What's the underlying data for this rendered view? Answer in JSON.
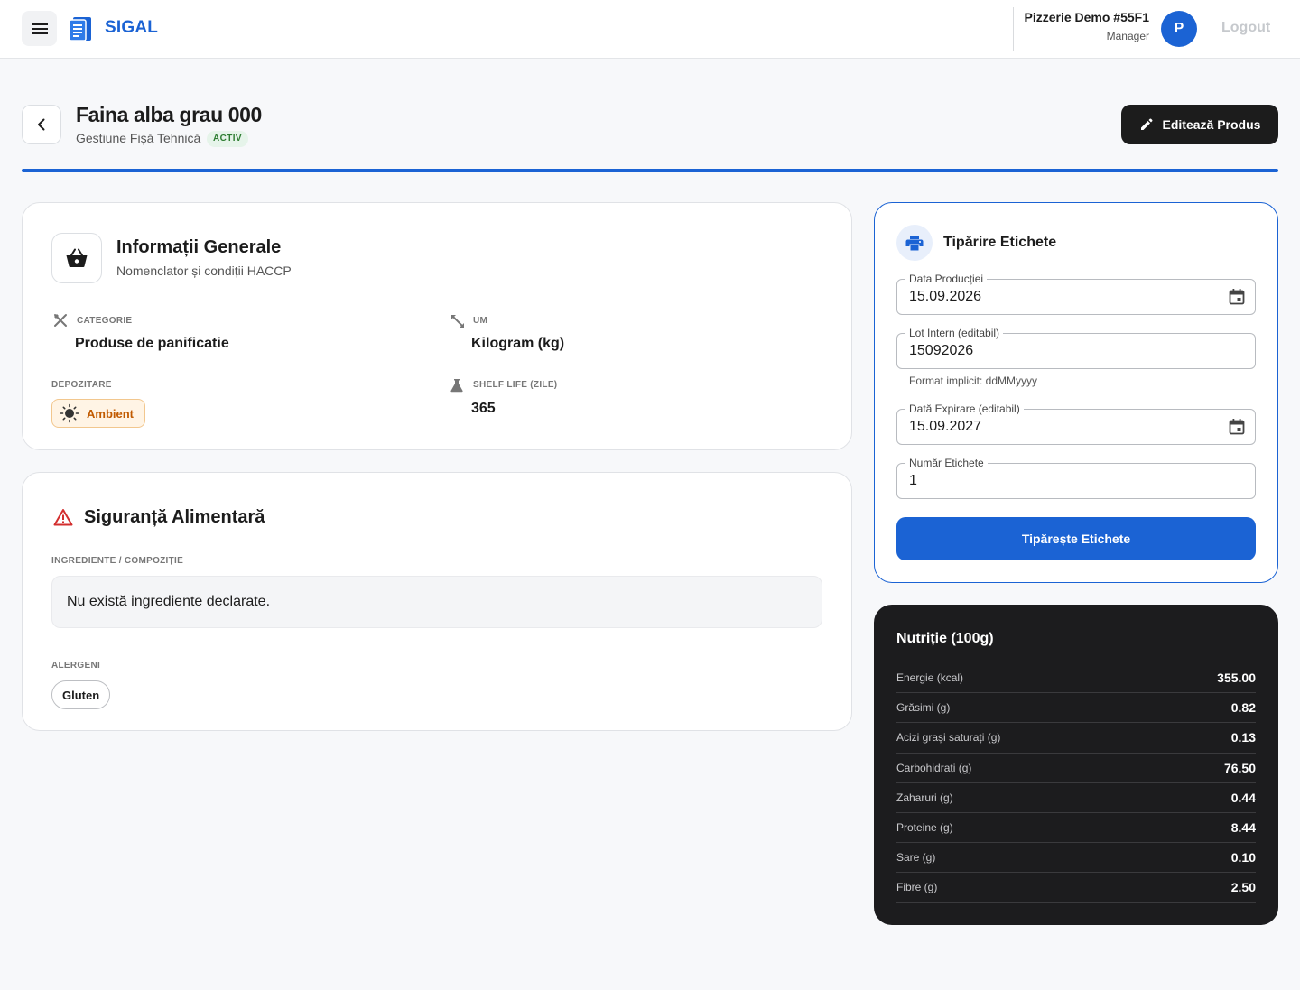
{
  "app": {
    "brand": "SIGAL"
  },
  "user": {
    "name": "Pizzerie Demo #55F1",
    "role": "Manager",
    "avatar_initial": "P",
    "logout_label": "Logout"
  },
  "page": {
    "title": "Faina alba grau 000",
    "subtitle": "Gestiune Fișă Tehnică",
    "status": "ACTIV",
    "edit_label": "Editează Produs"
  },
  "general": {
    "title": "Informații Generale",
    "subtitle": "Nomenclator și condiții HACCP",
    "category_label": "CATEGORIE",
    "category_value": "Produse de panificatie",
    "um_label": "UM",
    "um_value": "Kilogram (kg)",
    "storage_label": "DEPOZITARE",
    "storage_value": "Ambient",
    "shelf_label": "SHELF LIFE (ZILE)",
    "shelf_value": "365"
  },
  "safety": {
    "title": "Siguranță Alimentară",
    "ingredients_label": "INGREDIENTE / COMPOZIȚIE",
    "ingredients_value": "Nu există ingrediente declarate.",
    "allergens_label": "ALERGENI",
    "allergens": [
      "Gluten"
    ]
  },
  "print": {
    "title": "Tipărire Etichete",
    "production_date_label": "Data Producției",
    "production_date_value": "15.09.2026",
    "lot_label": "Lot Intern (editabil)",
    "lot_value": "15092026",
    "lot_hint": "Format implicit: ddMMyyyy",
    "expiry_label": "Dată Expirare (editabil)",
    "expiry_value": "15.09.2027",
    "count_label": "Număr Etichete",
    "count_value": "1",
    "button_label": "Tipărește Etichete"
  },
  "nutrition": {
    "title": "Nutriție (100g)",
    "rows": [
      {
        "label": "Energie (kcal)",
        "value": "355.00"
      },
      {
        "label": "Grăsimi (g)",
        "value": "0.82"
      },
      {
        "label": "Acizi grași saturați (g)",
        "value": "0.13"
      },
      {
        "label": "Carbohidrați (g)",
        "value": "76.50"
      },
      {
        "label": "Zaharuri (g)",
        "value": "0.44"
      },
      {
        "label": "Proteine (g)",
        "value": "8.44"
      },
      {
        "label": "Sare (g)",
        "value": "0.10"
      },
      {
        "label": "Fibre (g)",
        "value": "2.50"
      }
    ]
  },
  "colors": {
    "accent": "#1b63d4",
    "dark": "#1c1c1e",
    "ambient": "#c15a00",
    "active": "#2e7d32",
    "warning": "#d32f2f"
  },
  "icons": [
    "menu-icon",
    "document-logo-icon",
    "chevron-left-icon",
    "pencil-icon",
    "shopping-basket-icon",
    "utensils-icon",
    "resize-arrows-icon",
    "sun-icon",
    "flask-icon",
    "warning-triangle-icon",
    "printer-icon",
    "calendar-icon"
  ]
}
